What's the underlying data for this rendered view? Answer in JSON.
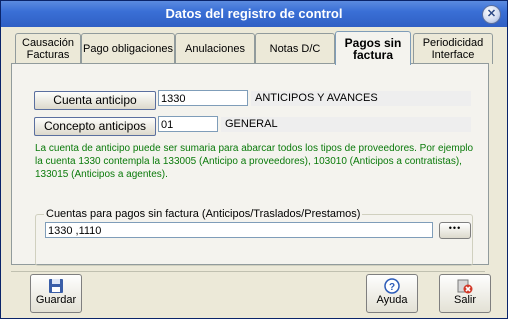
{
  "window": {
    "title": "Datos del registro de control",
    "close_symbol": "✕"
  },
  "tabs": [
    {
      "label": "Causación Facturas"
    },
    {
      "label": "Pago obligaciones"
    },
    {
      "label": "Anulaciones"
    },
    {
      "label": "Notas D/C"
    },
    {
      "label": "Pagos sin factura"
    },
    {
      "label": "Periodicidad Interface"
    }
  ],
  "panel": {
    "cuenta_anticipo": {
      "button_label": "Cuenta anticipo",
      "value": "1330",
      "description": "ANTICIPOS Y AVANCES"
    },
    "concepto_anticipos": {
      "button_label": "Concepto anticipos",
      "value": "01",
      "description": "GENERAL"
    },
    "note": "La cuenta de anticipo puede ser sumaria para abarcar todos los tipos de proveedores. Por ejemplo la cuenta 1330 contempla la 133005 (Anticipo a proveedores), 103010 (Anticipos a contratistas), 133015 (Anticipos a agentes).",
    "group": {
      "caption": "Cuentas para pagos sin factura (Anticipos/Traslados/Prestamos)",
      "value": "1330     ,1110",
      "dots_label": "•••"
    }
  },
  "footer": {
    "guardar": {
      "label": "Guardar",
      "icon": "floppy-disk-icon"
    },
    "ayuda": {
      "label": "Ayuda",
      "icon": "question-icon"
    },
    "salir": {
      "label": "Salir",
      "icon": "exit-icon"
    }
  },
  "colors": {
    "titlebar": "#3a6fd6",
    "note_text": "#0a7a0a",
    "accent_tab_border": "#7f9db9"
  }
}
